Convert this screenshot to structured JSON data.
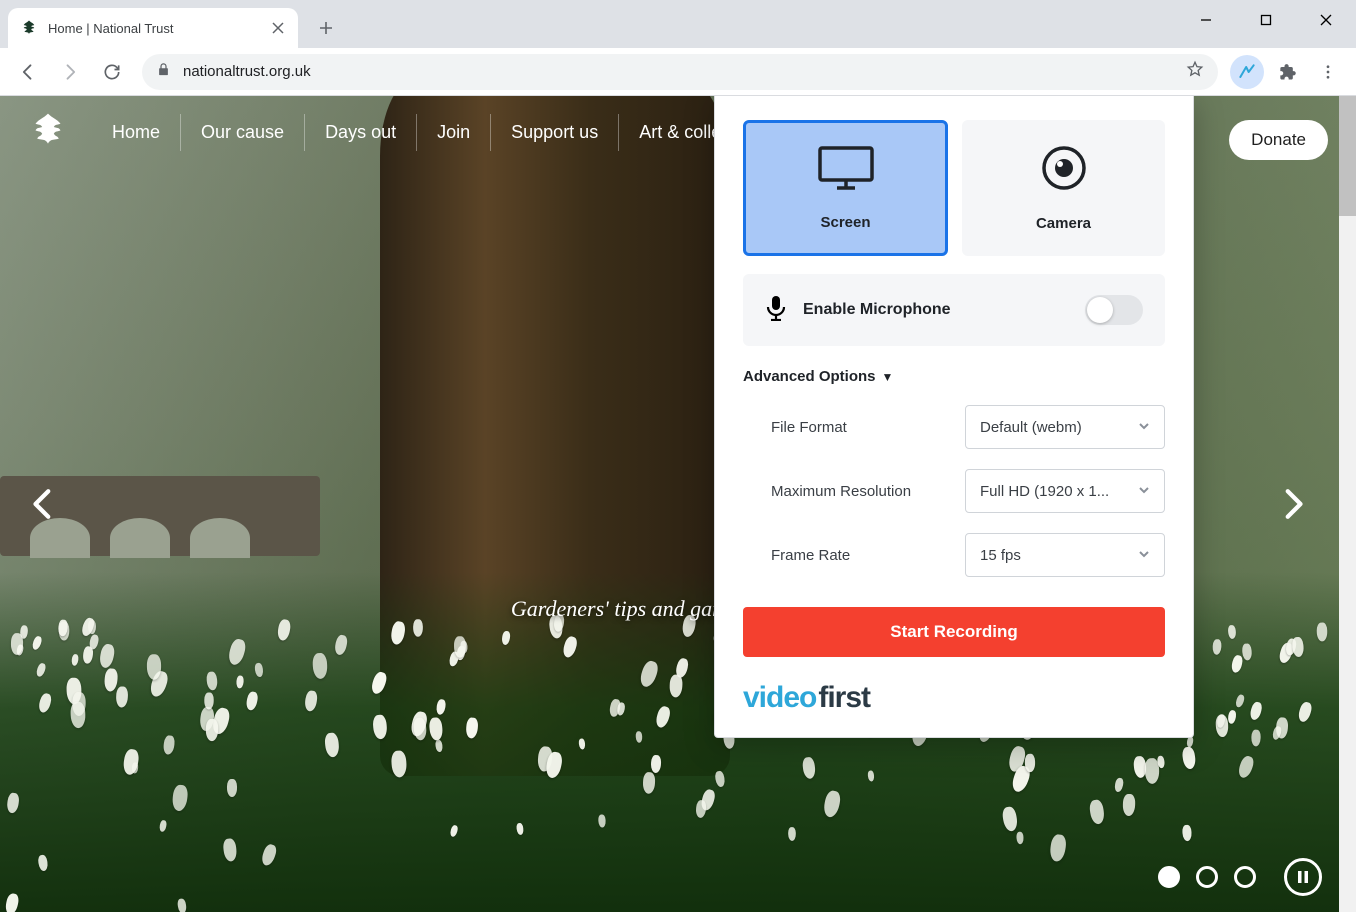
{
  "browser": {
    "tab_title": "Home | National Trust",
    "url": "nationaltrust.org.uk"
  },
  "site": {
    "nav": [
      "Home",
      "Our cause",
      "Days out",
      "Join",
      "Support us",
      "Art & collections"
    ],
    "donate": "Donate",
    "hero_caption": "Gardeners' tips and garden highlights"
  },
  "popup": {
    "modes": {
      "screen": "Screen",
      "camera": "Camera"
    },
    "microphone_label": "Enable Microphone",
    "advanced_label": "Advanced Options",
    "options": {
      "file_format": {
        "label": "File Format",
        "value": "Default (webm)"
      },
      "max_resolution": {
        "label": "Maximum Resolution",
        "value": "Full HD (1920 x 1..."
      },
      "frame_rate": {
        "label": "Frame Rate",
        "value": "15 fps"
      }
    },
    "start_button": "Start Recording",
    "brand_a": "video",
    "brand_b": "first"
  }
}
